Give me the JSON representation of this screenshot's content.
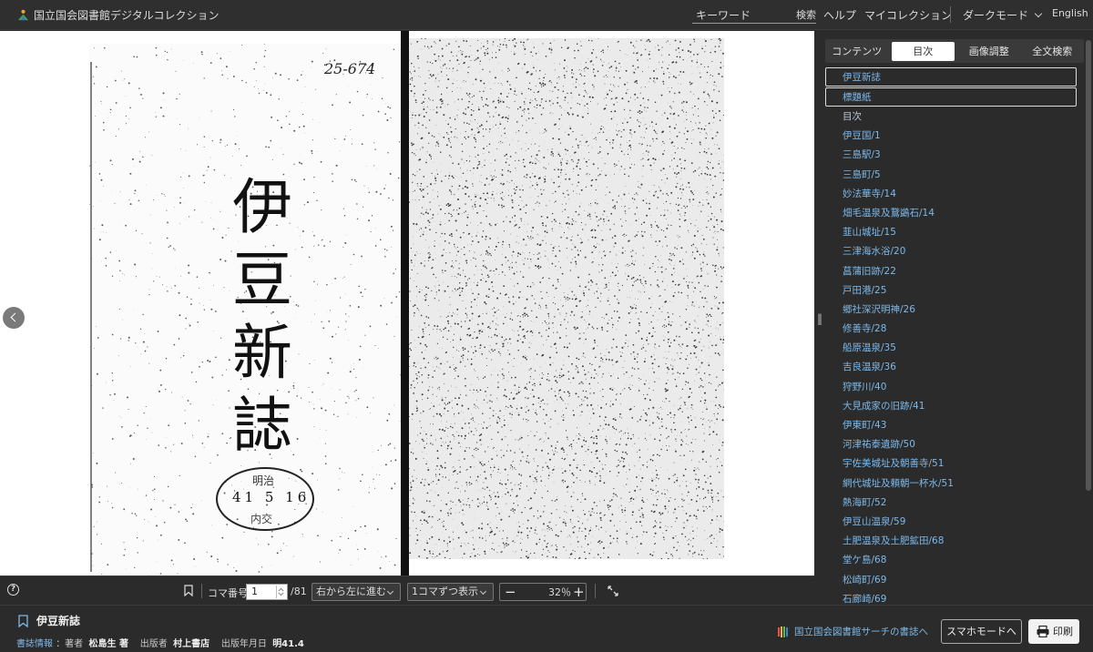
{
  "app": {
    "title": "国立国会図書館デジタルコレクション"
  },
  "header": {
    "search_placeholder": "キーワード",
    "search_button": "検索",
    "help": "ヘルプ",
    "my_collection": "マイコレクション",
    "dark_mode": "ダークモード",
    "language": "English"
  },
  "document_image": {
    "title_chars": [
      "伊",
      "豆",
      "新",
      "誌"
    ],
    "handwritten_note": "25-674",
    "stamp": {
      "line1": "明治",
      "line2": "41 5 16",
      "line3": "内交"
    }
  },
  "sidebar": {
    "tabs": [
      {
        "label": "コンテンツ",
        "active": false
      },
      {
        "label": "目次",
        "active": true
      },
      {
        "label": "画像調整",
        "active": false
      },
      {
        "label": "全文検索",
        "active": false
      }
    ],
    "toc": [
      "伊豆新誌",
      "標題紙",
      "目次",
      "伊豆国/1",
      "三島駅/3",
      "三島町/5",
      "妙法華寺/14",
      "畑毛温泉及鵞鷁石/14",
      "韮山城址/15",
      "三津海水浴/20",
      "菖蒲旧跡/22",
      "戸田港/25",
      "郷社深沢明神/26",
      "修善寺/28",
      "船原温泉/35",
      "吉良温泉/36",
      "狩野川/40",
      "大見成家の旧跡/41",
      "伊東町/43",
      "河津祐泰遺跡/50",
      "宇佐美城址及朝善寺/51",
      "網代城址及頼朝一杯水/51",
      "熱海町/52",
      "伊豆山温泉/59",
      "土肥温泉及土肥鉱田/68",
      "堂ケ島/68",
      "松崎町/69",
      "石廊崎/69"
    ]
  },
  "controls": {
    "frame_label": "コマ番号",
    "frame_value": "1",
    "frame_total": "/81",
    "direction": "右から左に進む",
    "display_mode": "1コマずつ表示",
    "zoom": "32％"
  },
  "footer": {
    "title": "伊豆新誌",
    "biblio_link": "書誌情報",
    "author_label": "：著者",
    "author": "松島生 著",
    "publisher_label": "出版者",
    "publisher": "村上書店",
    "date_label": "出版年月日",
    "date": "明41.4",
    "ndl_search_link": "国立国会図書館サーチの書誌へ",
    "mobile_mode": "スマホモードへ",
    "print": "印刷"
  },
  "colors": {
    "background": "#2b2b2b",
    "link": "#7db8e8",
    "text": "#e6e6e6"
  }
}
